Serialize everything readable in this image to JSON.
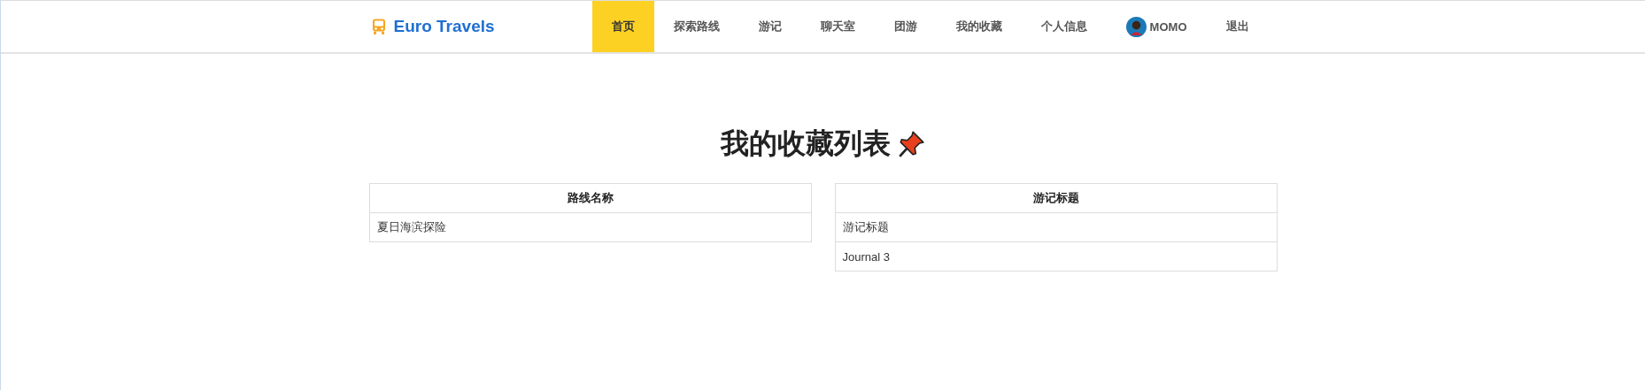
{
  "brand": {
    "name": "Euro Travels"
  },
  "nav": [
    {
      "label": "首页",
      "selected": true
    },
    {
      "label": "探索路线",
      "selected": false
    },
    {
      "label": "游记",
      "selected": false
    },
    {
      "label": "聊天室",
      "selected": false
    },
    {
      "label": "团游",
      "selected": false
    },
    {
      "label": "我的收藏",
      "selected": false
    },
    {
      "label": "个人信息",
      "selected": false
    },
    {
      "label": "MOMO",
      "selected": false,
      "kind": "user"
    },
    {
      "label": "退出",
      "selected": false
    }
  ],
  "heading": "我的收藏列表",
  "tables": [
    {
      "column": "路线名称",
      "rows": [
        "夏日海滨探险"
      ]
    },
    {
      "column": "游记标题",
      "rows": [
        "游记标题",
        "Journal 3"
      ]
    }
  ]
}
